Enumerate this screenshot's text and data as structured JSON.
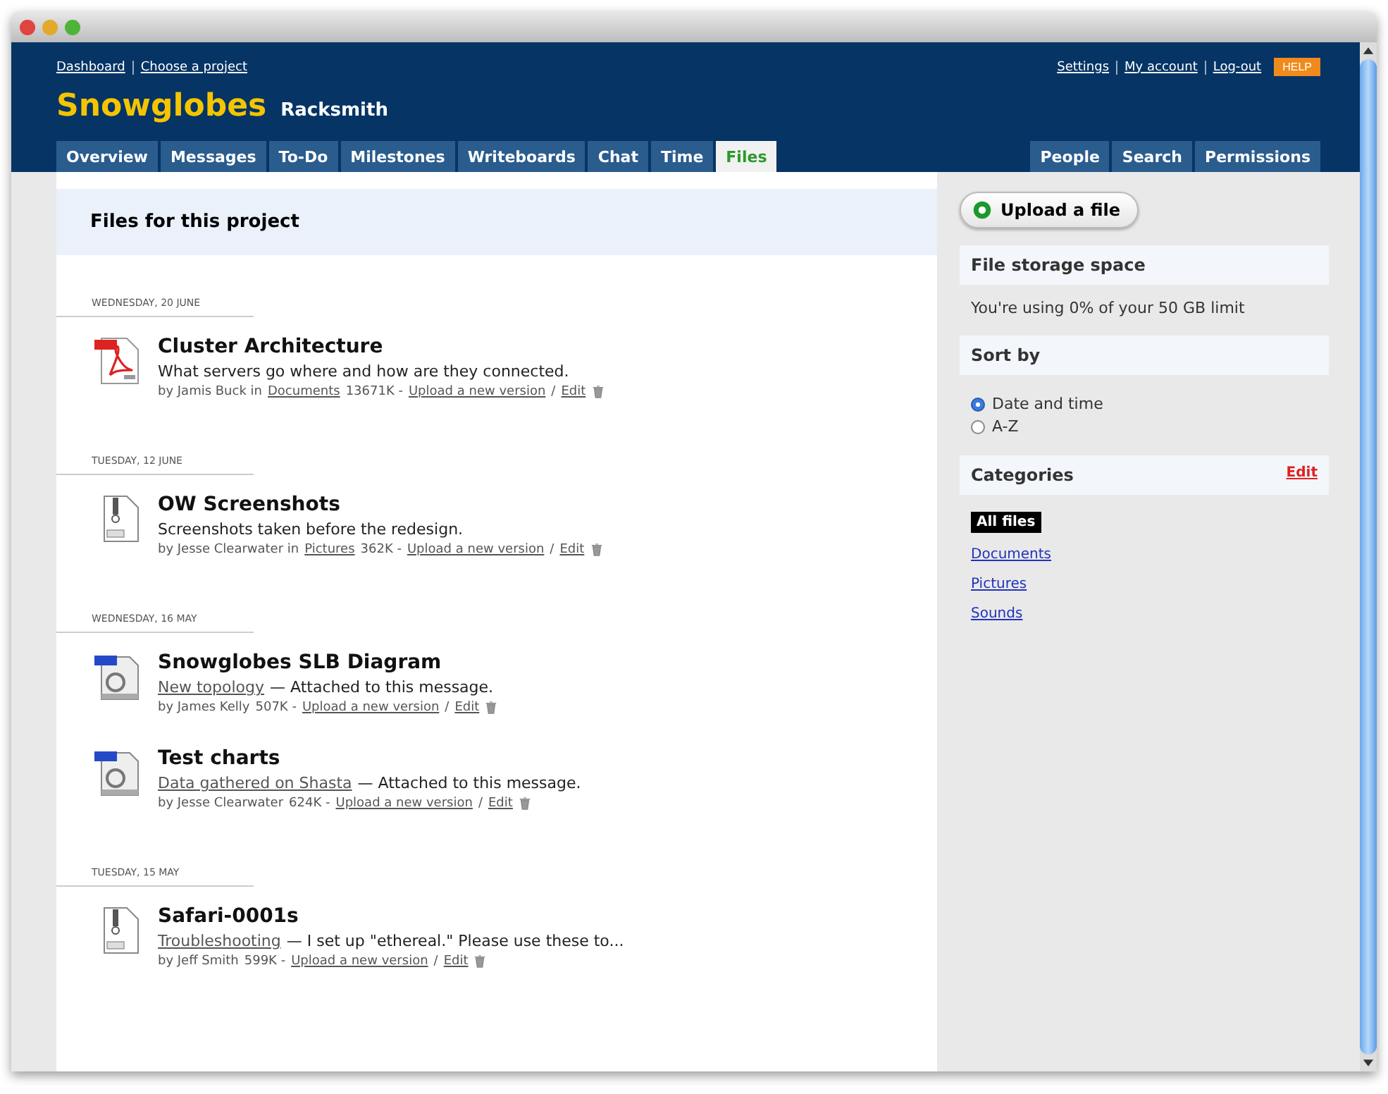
{
  "top_links": {
    "left": [
      "Dashboard",
      "Choose a project"
    ],
    "right": [
      "Settings",
      "My account",
      "Log-out"
    ],
    "help": "HELP"
  },
  "project": {
    "name": "Snowglobes",
    "company": "Racksmith"
  },
  "tabs": [
    {
      "label": "Overview",
      "selected": false
    },
    {
      "label": "Messages",
      "selected": false
    },
    {
      "label": "To-Do",
      "selected": false
    },
    {
      "label": "Milestones",
      "selected": false
    },
    {
      "label": "Writeboards",
      "selected": false
    },
    {
      "label": "Chat",
      "selected": false
    },
    {
      "label": "Time",
      "selected": false
    },
    {
      "label": "Files",
      "selected": true
    }
  ],
  "right_tabs": [
    {
      "label": "People",
      "selected": false
    },
    {
      "label": "Search",
      "selected": false
    },
    {
      "label": "Permissions",
      "selected": false
    }
  ],
  "main": {
    "title": "Files for this project",
    "groups": [
      {
        "date": "WEDNESDAY, 20 JUNE",
        "files": [
          {
            "kind": "pdf",
            "title": "Cluster Architecture",
            "description": {
              "text": "What servers go where and how are they connected."
            },
            "meta": {
              "author": "by Jamis Buck in",
              "category": "Documents",
              "size": "13671K -",
              "upload": "Upload a new version",
              "sep": "/",
              "edit": "Edit"
            }
          }
        ]
      },
      {
        "date": "TUESDAY, 12 JUNE",
        "files": [
          {
            "kind": "zip",
            "title": "OW Screenshots",
            "description": {
              "text": "Screenshots taken before the redesign."
            },
            "meta": {
              "author": "by Jesse Clearwater in",
              "category": "Pictures",
              "size": "362K -",
              "upload": "Upload a new version",
              "sep": "/",
              "edit": "Edit"
            }
          }
        ]
      },
      {
        "date": "WEDNESDAY, 16 MAY",
        "files": [
          {
            "kind": "image",
            "title": "Snowglobes SLB Diagram",
            "description": {
              "link": "New topology",
              "text": "— Attached to this message."
            },
            "meta": {
              "author": "by James Kelly",
              "size": "507K -",
              "upload": "Upload a new version",
              "sep": "/",
              "edit": "Edit"
            }
          },
          {
            "kind": "image",
            "title": "Test charts",
            "description": {
              "link": "Data gathered on Shasta",
              "text": "— Attached to this message."
            },
            "meta": {
              "author": "by Jesse Clearwater",
              "size": "624K -",
              "upload": "Upload a new version",
              "sep": "/",
              "edit": "Edit"
            }
          }
        ]
      },
      {
        "date": "TUESDAY, 15 MAY",
        "files": [
          {
            "kind": "zip",
            "title": "Safari-0001s",
            "description": {
              "link": "Troubleshooting",
              "text": "— I set up \"ethereal.\" Please use these to..."
            },
            "meta": {
              "author": "by Jeff Smith",
              "size": "599K -",
              "upload": "Upload a new version",
              "sep": "/",
              "edit": "Edit"
            }
          }
        ]
      }
    ]
  },
  "sidebar": {
    "upload_button": "Upload a file",
    "storage": {
      "title": "File storage space",
      "text": "You're using 0% of your 50 GB limit"
    },
    "sort": {
      "title": "Sort by",
      "options": [
        {
          "label": "Date and time",
          "selected": true
        },
        {
          "label": "A-Z",
          "selected": false
        }
      ]
    },
    "categories": {
      "title": "Categories",
      "edit": "Edit",
      "items": [
        {
          "label": "All files",
          "selected": true
        },
        {
          "label": "Documents",
          "selected": false
        },
        {
          "label": "Pictures",
          "selected": false
        },
        {
          "label": "Sounds",
          "selected": false
        }
      ]
    }
  }
}
